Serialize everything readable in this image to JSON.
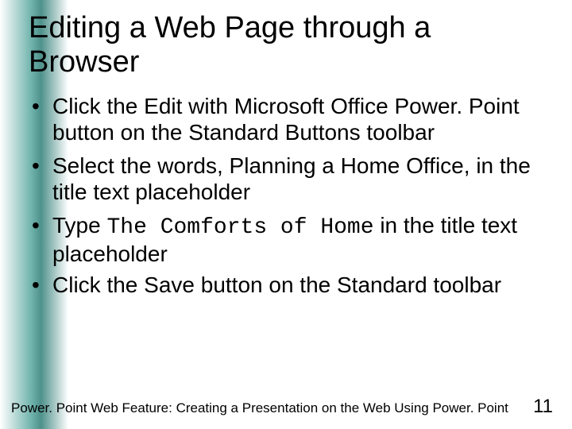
{
  "slide": {
    "title": "Editing a Web Page through a Browser",
    "bullets": [
      {
        "before": "Click the Edit with Microsoft Office Power. Point button on the Standard Buttons toolbar",
        "mono": "",
        "after": ""
      },
      {
        "before": "Select the words, Planning a Home Office, in the title text placeholder",
        "mono": "",
        "after": ""
      },
      {
        "before": "Type ",
        "mono": "The Comforts of Home",
        "after": " in the title text placeholder"
      },
      {
        "before": "Click the Save button on the Standard toolbar",
        "mono": "",
        "after": ""
      }
    ]
  },
  "footer": {
    "text": "Power. Point Web Feature: Creating a Presentation on the Web Using Power. Point",
    "page": "11"
  }
}
